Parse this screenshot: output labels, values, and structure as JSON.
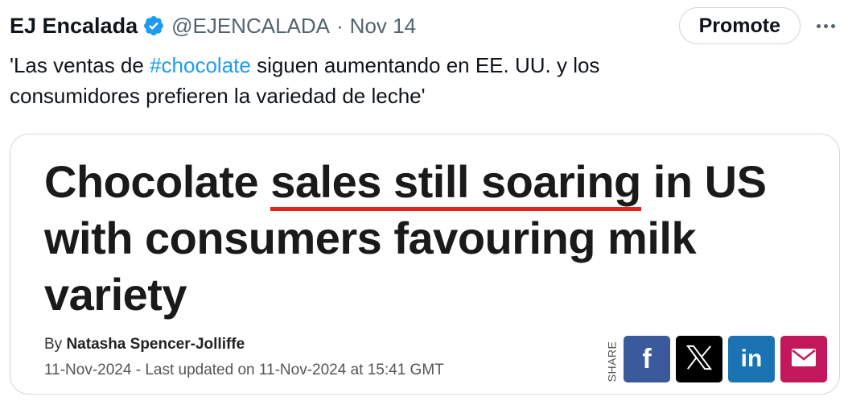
{
  "tweet": {
    "author_name": "EJ Encalada",
    "handle": "@EJENCALADA",
    "separator": "·",
    "date": "Nov 14",
    "promote_label": "Promote",
    "text_before": "'Las ventas de ",
    "hashtag": "#chocolate",
    "text_after": " siguen aumentando en EE. UU. y los consumidores prefieren la variedad de leche'"
  },
  "card": {
    "headline_part1": "Chocolate ",
    "headline_underlined": "sales still soaring",
    "headline_part2": " in US with consumers favouring milk variety",
    "byline_prefix": "By ",
    "byline_author": "Natasha Spencer-Jolliffe",
    "timestamp": "11-Nov-2024 - Last updated on 11-Nov-2024 at 15:41 GMT",
    "share_label": "SHARE"
  },
  "share_buttons": [
    {
      "name": "facebook",
      "icon": "facebook-icon",
      "color": "#3a5a9b"
    },
    {
      "name": "x",
      "icon": "x-icon",
      "color": "#000000"
    },
    {
      "name": "linkedin",
      "icon": "linkedin-icon",
      "color": "#1a73b3"
    },
    {
      "name": "email",
      "icon": "mail-icon",
      "color": "#c2185b"
    }
  ],
  "colors": {
    "hashtag": "#1d9bf0",
    "verified": "#1d9bf0",
    "underline": "#e3211e"
  }
}
